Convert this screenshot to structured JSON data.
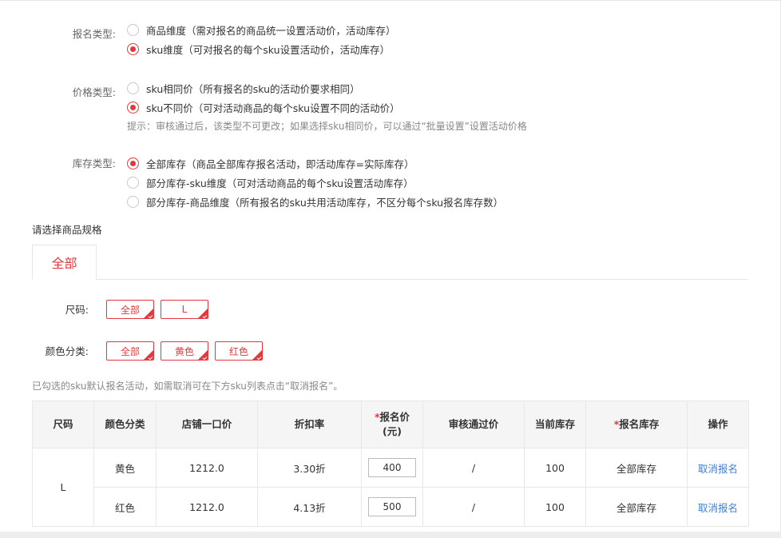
{
  "signup_type": {
    "label": "报名类型:",
    "options": [
      {
        "label": "商品维度（需对报名的商品统一设置活动价，活动库存）",
        "checked": false
      },
      {
        "label": "sku维度（可对报名的每个sku设置活动价，活动库存）",
        "checked": true
      }
    ]
  },
  "price_type": {
    "label": "价格类型:",
    "options": [
      {
        "label": "sku相同价（所有报名的sku的活动价要求相同）",
        "checked": false
      },
      {
        "label": "sku不同价（可对活动商品的每个sku设置不同的活动价）",
        "checked": true
      }
    ],
    "hint": "提示：审核通过后，该类型不可更改；如果选择sku相同价，可以通过“批量设置”设置活动价格"
  },
  "stock_type": {
    "label": "库存类型:",
    "options": [
      {
        "label": "全部库存（商品全部库存报名活动，即活动库存=实际库存）",
        "checked": true
      },
      {
        "label": "部分库存-sku维度（可对活动商品的每个sku设置活动库存）",
        "checked": false
      },
      {
        "label": "部分库存-商品维度（所有报名的sku共用活动库存，不区分每个sku报名库存数）",
        "checked": false
      }
    ]
  },
  "spec_section": {
    "title": "请选择商品规格",
    "tab_label": "全部",
    "size": {
      "label": "尺码:",
      "chips": [
        "全部",
        "L"
      ]
    },
    "color": {
      "label": "颜色分类:",
      "chips": [
        "全部",
        "黄色",
        "红色"
      ]
    },
    "note": "已勾选的sku默认报名活动，如需取消可在下方sku列表点击“取消报名”。"
  },
  "accent_color": "#e4393c",
  "link_color": "#3b80d8",
  "table": {
    "headers": {
      "size": "尺码",
      "color": "颜色分类",
      "store_price": "店铺一口价",
      "discount": "折扣率",
      "signup_price_required": "*",
      "signup_price": "报名价",
      "signup_price_unit": "(元)",
      "approved_price": "审核通过价",
      "current_stock": "当前库存",
      "signup_stock_required": "*",
      "signup_stock": "报名库存",
      "action": "操作"
    },
    "size_group": "L",
    "rows": [
      {
        "color": "黄色",
        "store_price": "1212.0",
        "discount": "3.30折",
        "signup_price": "400",
        "approved_price": "/",
        "current_stock": "100",
        "signup_stock": "全部库存",
        "action": "取消报名"
      },
      {
        "color": "红色",
        "store_price": "1212.0",
        "discount": "4.13折",
        "signup_price": "500",
        "approved_price": "/",
        "current_stock": "100",
        "signup_stock": "全部库存",
        "action": "取消报名"
      }
    ]
  }
}
